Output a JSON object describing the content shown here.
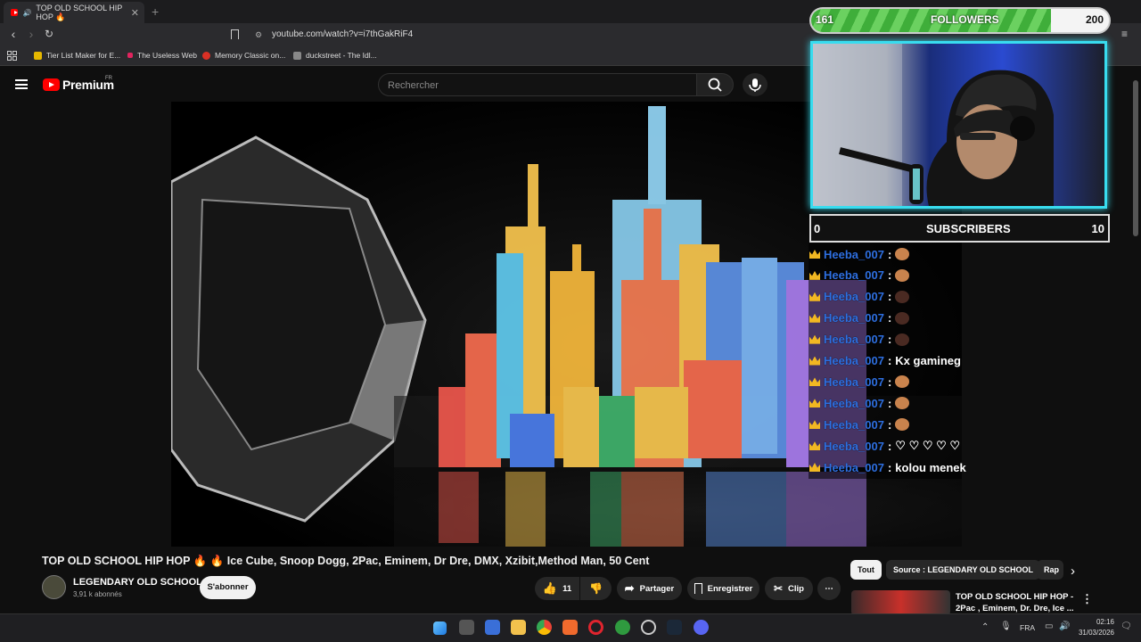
{
  "browser": {
    "tab_title": "TOP OLD SCHOOL HIP HOP 🔥",
    "tab_close": "✕",
    "new_tab": "+",
    "url": "youtube.com/watch?v=i7thGakRiF4",
    "bookmarks": [
      {
        "label": "Tier List Maker for E...",
        "color": "#e6b800"
      },
      {
        "label": "The Useless Web",
        "color": "#e0245e"
      },
      {
        "label": "Memory Classic on...",
        "color": "#d93025"
      },
      {
        "label": "duckstreet - The Idl...",
        "color": "#888888"
      }
    ]
  },
  "youtube": {
    "logo_text": "Premium",
    "logo_country": "FR",
    "search_placeholder": "Rechercher"
  },
  "video": {
    "title": "TOP OLD SCHOOL HIP HOP 🔥 🔥 Ice Cube, Snoop Dogg, 2Pac, Eminem, Dr Dre, DMX, Xzibit,Method Man, 50 Cent",
    "channel_name": "LEGENDARY OLD SCHOOL",
    "channel_subs": "3,91 k abonnés",
    "subscribe_label": "S'abonner",
    "likes": "11",
    "share_label": "Partager",
    "save_label": "Enregistrer",
    "clip_label": "Clip",
    "more_label": "⋯"
  },
  "chips": {
    "all": "Tout",
    "source": "Source : LEGENDARY OLD SCHOOL",
    "rap": "Rap"
  },
  "recommendation": {
    "title_line1": "TOP OLD SCHOOL HIP HOP -",
    "title_line2": "2Pac , Eminem, Dr. Dre, Ice ..."
  },
  "overlay": {
    "followers_label": "FOLLOWERS",
    "followers_current": "161",
    "followers_goal": "200",
    "followers_progress": 0.805,
    "subscribers_label": "SUBSCRIBERS",
    "subscribers_current": "0",
    "subscribers_goal": "10",
    "chat": [
      {
        "user": "Heeba_007",
        "sep": ":",
        "msg": "",
        "emote": "light"
      },
      {
        "user": "Heeba_007",
        "sep": ":",
        "msg": "",
        "emote": "light"
      },
      {
        "user": "Heeba_007",
        "sep": ":",
        "msg": "",
        "emote": "dark"
      },
      {
        "user": "Heeba_007",
        "sep": ":",
        "msg": "",
        "emote": "dark"
      },
      {
        "user": "Heeba_007",
        "sep": ":",
        "msg": "",
        "emote": "dark"
      },
      {
        "user": "Heeba_007",
        "sep": ":",
        "msg": "Kx gamineg",
        "emote": ""
      },
      {
        "user": "Heeba_007",
        "sep": ":",
        "msg": "",
        "emote": "light"
      },
      {
        "user": "Heeba_007",
        "sep": ":",
        "msg": "",
        "emote": "light"
      },
      {
        "user": "Heeba_007",
        "sep": ":",
        "msg": "",
        "emote": "light"
      },
      {
        "user": "Heeba_007",
        "sep": ":",
        "msg": "♡ ♡ ♡ ♡ ♡",
        "emote": ""
      },
      {
        "user": "Heeba_007",
        "sep": ":",
        "msg": "kolou menek",
        "emote": ""
      }
    ]
  },
  "taskbar": {
    "lang": "FRA",
    "time": "02:16",
    "date": "31/03/2026"
  }
}
